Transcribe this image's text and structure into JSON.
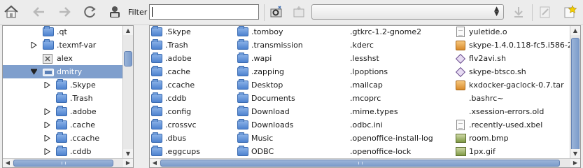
{
  "toolbar": {
    "filter_label": "Filter",
    "filter_value": "",
    "location_value": ""
  },
  "tree": {
    "items": [
      {
        "label": ".qt",
        "expander": "none",
        "icon": "folder-icon",
        "selected": false
      },
      {
        "label": ".texmf-var",
        "expander": "collapsed",
        "icon": "folder-icon",
        "selected": false
      },
      {
        "label": "alex",
        "expander": "none",
        "icon": "locked-folder-icon",
        "selected": false
      },
      {
        "label": "dmitry",
        "expander": "expanded",
        "icon": "home-drive-icon",
        "selected": true
      },
      {
        "label": ".Skype",
        "expander": "collapsed",
        "icon": "folder-icon",
        "selected": false
      },
      {
        "label": ".Trash",
        "expander": "none",
        "icon": "folder-icon",
        "selected": false
      },
      {
        "label": ".adobe",
        "expander": "collapsed",
        "icon": "folder-icon",
        "selected": false
      },
      {
        "label": ".cache",
        "expander": "collapsed",
        "icon": "folder-icon",
        "selected": false
      },
      {
        "label": ".ccache",
        "expander": "collapsed",
        "icon": "folder-icon",
        "selected": false
      },
      {
        "label": ".cddb",
        "expander": "collapsed",
        "icon": "folder-icon",
        "selected": false
      }
    ]
  },
  "files": {
    "columns": [
      [
        {
          "name": ".Skype",
          "icon": "folder"
        },
        {
          "name": ".Trash",
          "icon": "folder"
        },
        {
          "name": ".adobe",
          "icon": "folder"
        },
        {
          "name": ".cache",
          "icon": "folder"
        },
        {
          "name": ".ccache",
          "icon": "folder"
        },
        {
          "name": ".cddb",
          "icon": "folder"
        },
        {
          "name": ".config",
          "icon": "folder"
        },
        {
          "name": ".crossvc",
          "icon": "folder"
        },
        {
          "name": ".dbus",
          "icon": "folder"
        },
        {
          "name": ".eggcups",
          "icon": "folder"
        }
      ],
      [
        {
          "name": ".tomboy",
          "icon": "folder"
        },
        {
          "name": ".transmission",
          "icon": "folder"
        },
        {
          "name": ".wapi",
          "icon": "folder"
        },
        {
          "name": ".zapping",
          "icon": "folder"
        },
        {
          "name": "Desktop",
          "icon": "folder"
        },
        {
          "name": "Documents",
          "icon": "folder"
        },
        {
          "name": "Download",
          "icon": "folder"
        },
        {
          "name": "Downloads",
          "icon": "folder"
        },
        {
          "name": "Music",
          "icon": "folder"
        },
        {
          "name": "ODBC",
          "icon": "folder"
        }
      ],
      [
        {
          "name": ".gtkrc-1.2-gnome2",
          "icon": "none"
        },
        {
          "name": ".kderc",
          "icon": "none"
        },
        {
          "name": ".lesshst",
          "icon": "none"
        },
        {
          "name": ".lpoptions",
          "icon": "none"
        },
        {
          "name": ".mailcap",
          "icon": "none"
        },
        {
          "name": ".mcoprc",
          "icon": "none"
        },
        {
          "name": ".mime.types",
          "icon": "none"
        },
        {
          "name": ".odbc.ini",
          "icon": "none"
        },
        {
          "name": ".openoffice-install-log",
          "icon": "none"
        },
        {
          "name": ".openoffice-lock",
          "icon": "none"
        }
      ],
      [
        {
          "name": "yuletide.o",
          "icon": "file"
        },
        {
          "name": "skype-1.4.0.118-fc5.i586-2",
          "icon": "package"
        },
        {
          "name": "flv2avi.sh",
          "icon": "script"
        },
        {
          "name": "skype-btsco.sh",
          "icon": "script"
        },
        {
          "name": "kxdocker-gaclock-0.7.tar",
          "icon": "package"
        },
        {
          "name": ".bashrc~",
          "icon": "none"
        },
        {
          "name": ".xsession-errors.old",
          "icon": "none"
        },
        {
          "name": ".recently-used.xbel",
          "icon": "file"
        },
        {
          "name": "room.bmp",
          "icon": "image"
        },
        {
          "name": "1px.gif",
          "icon": "image"
        }
      ]
    ]
  }
}
